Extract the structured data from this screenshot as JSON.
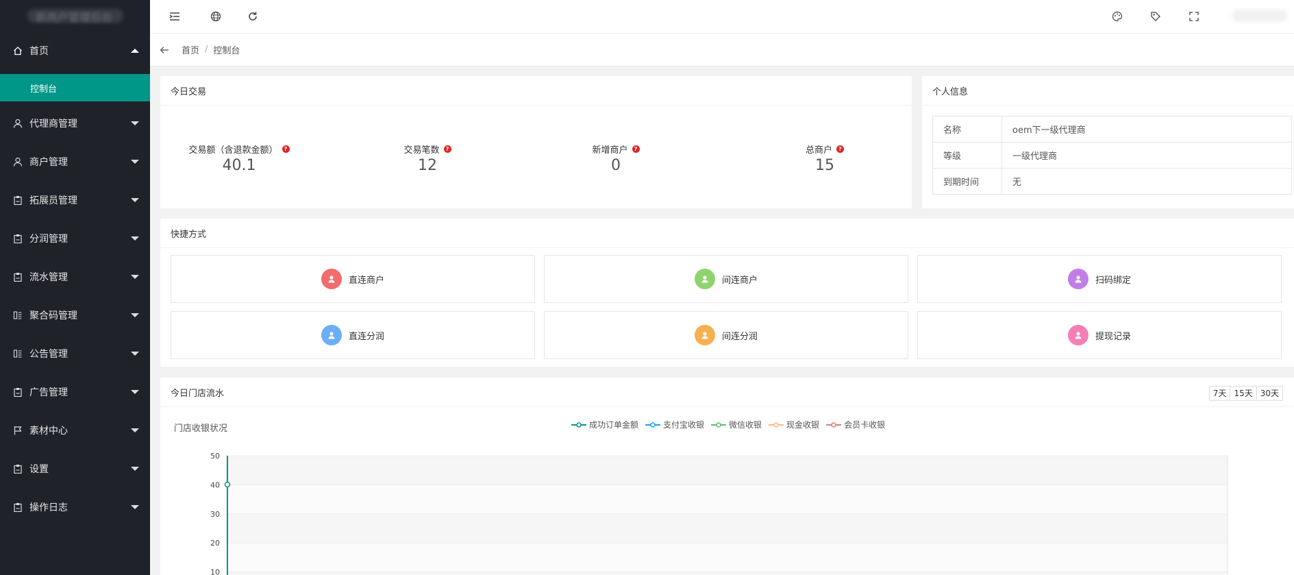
{
  "sidebar": {
    "logo_text": "新商户管理后台",
    "items": [
      {
        "label": "首页",
        "icon": "home-icon",
        "expanded": true
      },
      {
        "label": "代理商管理",
        "icon": "user-icon"
      },
      {
        "label": "商户管理",
        "icon": "user-icon"
      },
      {
        "label": "拓展员管理",
        "icon": "clipboard-icon"
      },
      {
        "label": "分润管理",
        "icon": "clipboard-icon"
      },
      {
        "label": "流水管理",
        "icon": "clipboard-icon"
      },
      {
        "label": "聚合码管理",
        "icon": "list-icon"
      },
      {
        "label": "公告管理",
        "icon": "list-icon"
      },
      {
        "label": "广告管理",
        "icon": "clipboard-icon"
      },
      {
        "label": "素材中心",
        "icon": "flag-icon"
      },
      {
        "label": "设置",
        "icon": "clipboard-icon"
      },
      {
        "label": "操作日志",
        "icon": "clipboard-icon"
      }
    ],
    "sub_active": "控制台"
  },
  "breadcrumb": {
    "home": "首页",
    "sep": "/",
    "current": "控制台"
  },
  "today": {
    "title": "今日交易",
    "stats": [
      {
        "label": "交易额（含退款金额）",
        "value": "40.1"
      },
      {
        "label": "交易笔数",
        "value": "12"
      },
      {
        "label": "新增商户",
        "value": "0"
      },
      {
        "label": "总商户",
        "value": "15"
      }
    ]
  },
  "profile": {
    "title": "个人信息",
    "rows": [
      {
        "k": "名称",
        "v": "oem下一级代理商"
      },
      {
        "k": "等级",
        "v": "一级代理商"
      },
      {
        "k": "到期时间",
        "v": "无"
      }
    ]
  },
  "shortcuts": {
    "title": "快捷方式",
    "items": [
      {
        "label": "直连商户",
        "color": "#f36b6b"
      },
      {
        "label": "间连商户",
        "color": "#8fd36f"
      },
      {
        "label": "扫码绑定",
        "color": "#c17ee8"
      },
      {
        "label": "直连分润",
        "color": "#6aaef6"
      },
      {
        "label": "间连分润",
        "color": "#f5b14f"
      },
      {
        "label": "提现记录",
        "color": "#f47fb6"
      }
    ]
  },
  "flow": {
    "title": "今日门店流水",
    "ranges": [
      "7天",
      "15天",
      "30天"
    ]
  },
  "chart_data": {
    "type": "line",
    "title": "门店收银状况",
    "ylim": [
      0,
      50
    ],
    "yticks": [
      "50",
      "40",
      "30",
      "20",
      "10"
    ],
    "series": [
      {
        "name": "成功订单金额",
        "color": "#009688",
        "values": [
          40.1
        ]
      },
      {
        "name": "支付宝收银",
        "color": "#1e9fff",
        "values": []
      },
      {
        "name": "微信收银",
        "color": "#5fb878",
        "values": []
      },
      {
        "name": "现金收银",
        "color": "#ffb980",
        "values": []
      },
      {
        "name": "会员卡收银",
        "color": "#d87a80",
        "values": []
      }
    ]
  }
}
